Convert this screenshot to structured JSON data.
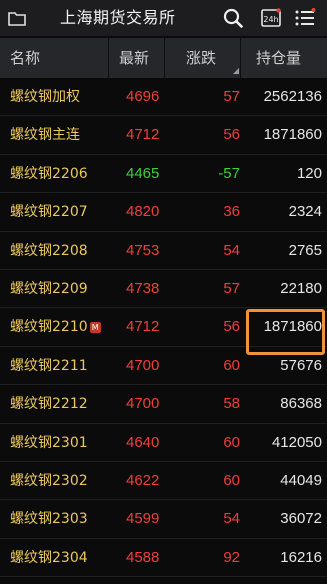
{
  "header": {
    "title": "上海期货交易所",
    "icons": [
      "folder-icon",
      "search-icon",
      "24h-icon",
      "menu-icon"
    ],
    "h24_label": "24h"
  },
  "columns": [
    "名称",
    "最新",
    "涨跌",
    "持仓量"
  ],
  "colors": {
    "up": "#f13d3d",
    "down": "#3fce3f",
    "name": "#e9c95c",
    "highlight": "#f0923a"
  },
  "rows": [
    {
      "name": "螺纹钢加权",
      "last": "4696",
      "change": "57",
      "open_interest": "2562136",
      "dir": "up"
    },
    {
      "name": "螺纹钢主连",
      "last": "4712",
      "change": "56",
      "open_interest": "1871860",
      "dir": "up"
    },
    {
      "name": "螺纹钢2206",
      "last": "4465",
      "change": "-57",
      "open_interest": "120",
      "dir": "down"
    },
    {
      "name": "螺纹钢2207",
      "last": "4820",
      "change": "36",
      "open_interest": "2324",
      "dir": "up"
    },
    {
      "name": "螺纹钢2208",
      "last": "4753",
      "change": "54",
      "open_interest": "2765",
      "dir": "up"
    },
    {
      "name": "螺纹钢2209",
      "last": "4738",
      "change": "57",
      "open_interest": "22180",
      "dir": "up"
    },
    {
      "name": "螺纹钢2210",
      "badge": "M",
      "last": "4712",
      "change": "56",
      "open_interest": "1871860",
      "dir": "up"
    },
    {
      "name": "螺纹钢2211",
      "last": "4700",
      "change": "60",
      "open_interest": "57676",
      "dir": "up"
    },
    {
      "name": "螺纹钢2212",
      "last": "4700",
      "change": "58",
      "open_interest": "86368",
      "dir": "up"
    },
    {
      "name": "螺纹钢2301",
      "last": "4640",
      "change": "60",
      "open_interest": "412050",
      "dir": "up"
    },
    {
      "name": "螺纹钢2302",
      "last": "4622",
      "change": "60",
      "open_interest": "44049",
      "dir": "up"
    },
    {
      "name": "螺纹钢2303",
      "last": "4599",
      "change": "54",
      "open_interest": "36072",
      "dir": "up"
    },
    {
      "name": "螺纹钢2304",
      "last": "4588",
      "change": "92",
      "open_interest": "16216",
      "dir": "up"
    }
  ]
}
